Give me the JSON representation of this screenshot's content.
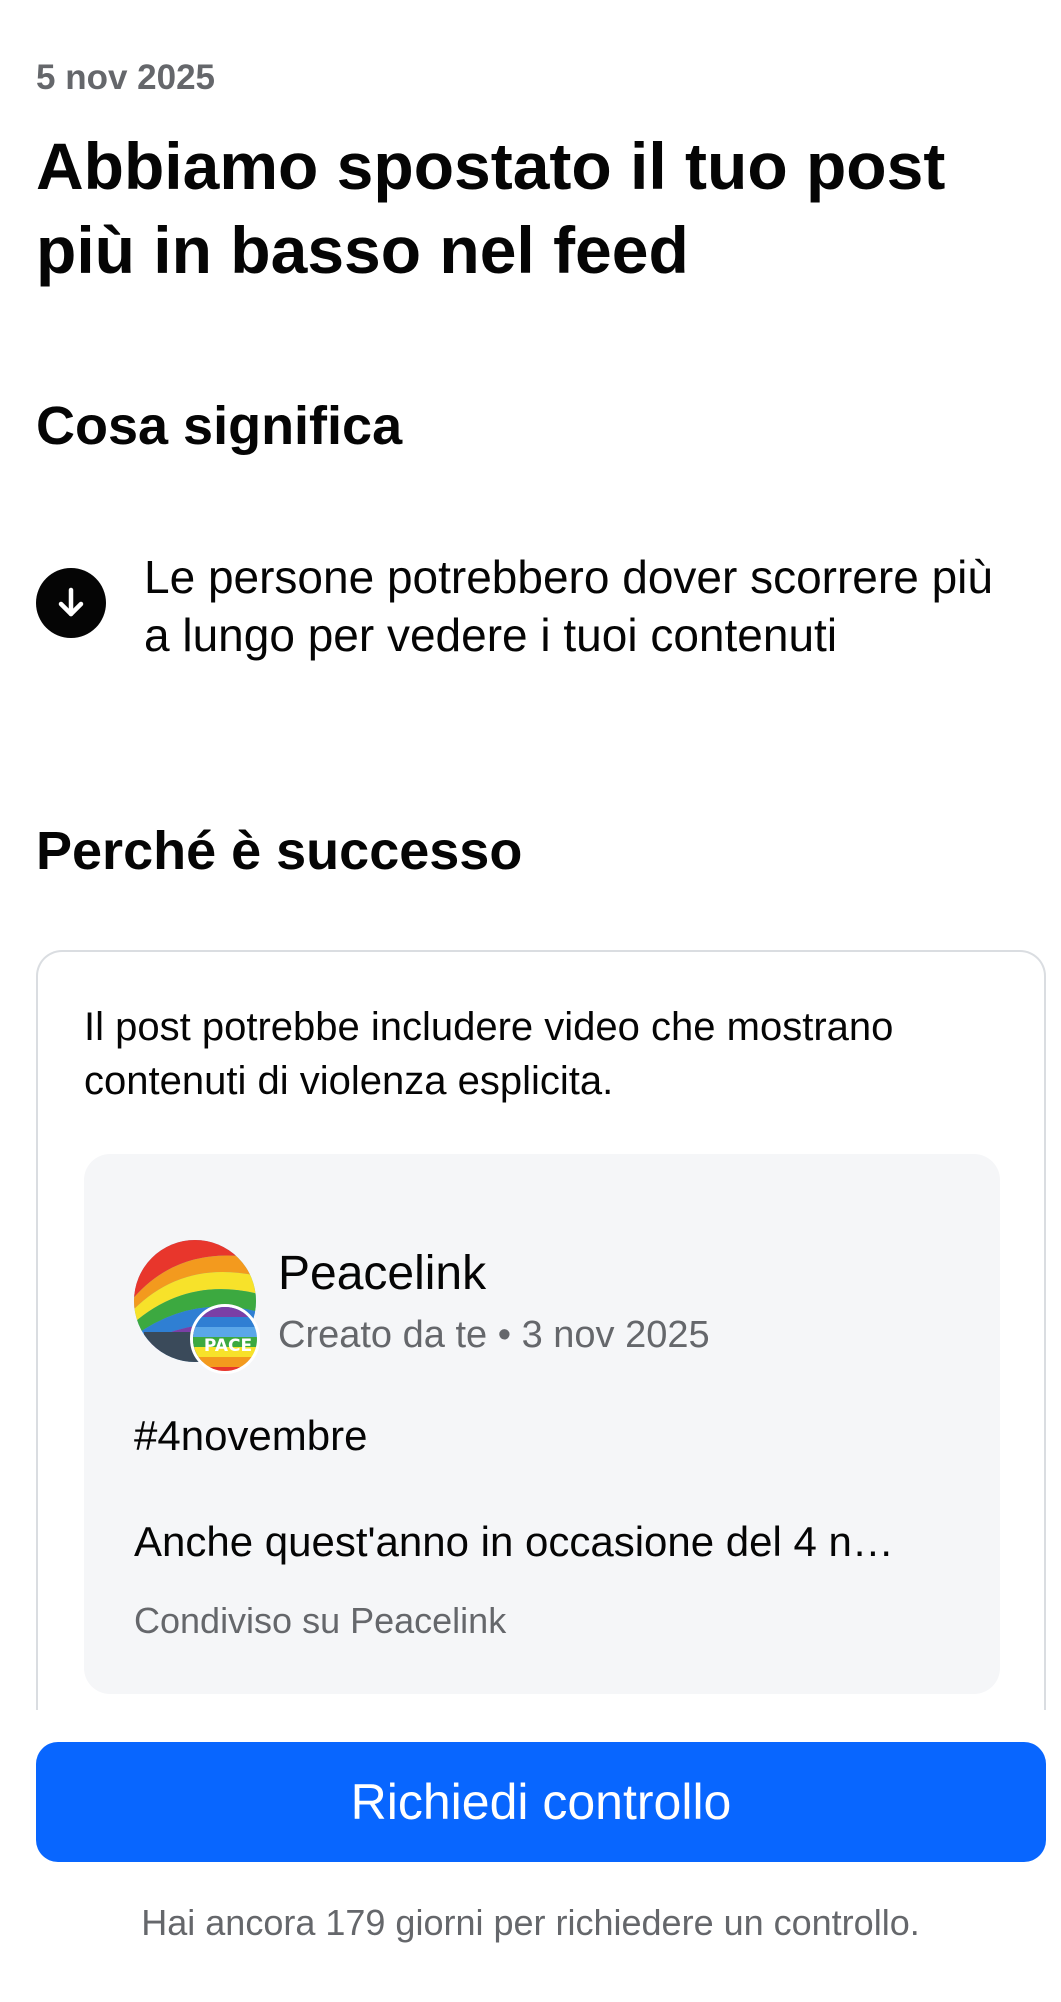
{
  "header": {
    "date": "5 nov 2025",
    "title": "Abbiamo spostato il tuo post più in basso nel feed"
  },
  "meaning": {
    "section_title": "Cosa significa",
    "icon": "arrow-down-circle-icon",
    "text": "Le persone potrebbero dover scorrere più a lungo per vedere i tuoi contenuti"
  },
  "reason": {
    "section_title": "Perché è successo",
    "text": "Il post potrebbe includere video che mostrano contenuti di violenza esplicita.",
    "post": {
      "page_name": "Peacelink",
      "created_by": "Creato da te",
      "separator": "•",
      "created_date": "3 nov 2025",
      "hashtag": "#4novembre",
      "excerpt": "Anche quest'anno in occasione del 4 n…",
      "shared_on": "Condiviso su Peacelink",
      "badge_text": "PACE"
    }
  },
  "actions": {
    "review_button": "Richiedi controllo",
    "remaining_note": "Hai ancora 179 giorni per richiedere un controllo."
  },
  "colors": {
    "primary": "#0866ff",
    "text": "#050505",
    "secondary_text": "#65676b",
    "card_background": "#f5f6f8"
  }
}
